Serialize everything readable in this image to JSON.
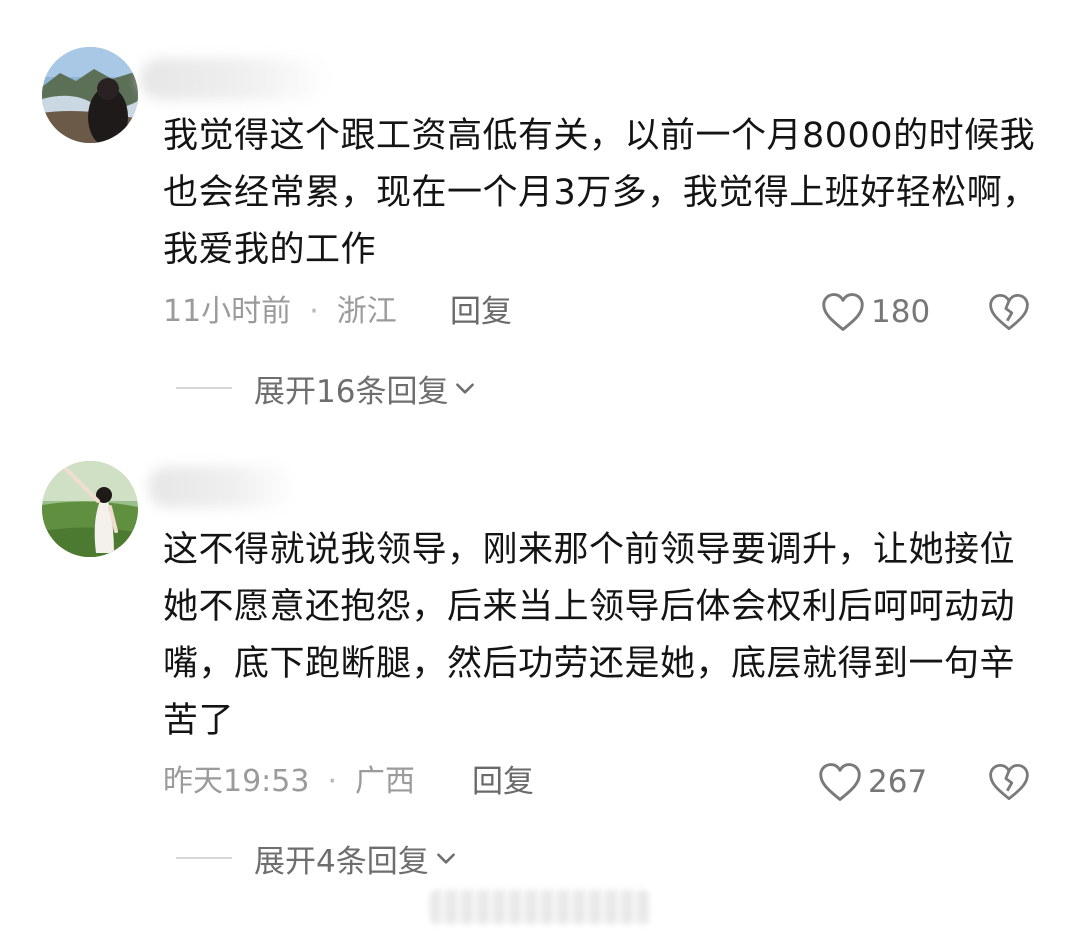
{
  "comments": [
    {
      "text": "我觉得这个跟工资高低有关，以前一个月8000的时候我也会经常累，现在一个月3万多，我觉得上班好轻松啊，我爱我的工作",
      "time": "11小时前",
      "separator": "·",
      "location": "浙江",
      "reply_label": "回复",
      "likes": "180",
      "expand_label": "展开16条回复",
      "avatar_icon": "landscape-avatar"
    },
    {
      "text": "这不得就说我领导，刚来那个前领导要调升，让她接位她不愿意还抱怨，后来当上领导后体会权利后呵呵动动嘴，底下跑断腿，然后功劳还是她，底层就得到一句辛苦了",
      "time": "昨天19:53",
      "separator": "·",
      "location": "广西",
      "reply_label": "回复",
      "likes": "267",
      "expand_label": "展开4条回复",
      "avatar_icon": "girl-grassland-avatar"
    }
  ],
  "icons": {
    "like": "heart-outline-icon",
    "dislike": "broken-heart-icon",
    "expand": "chevron-down-icon"
  },
  "colors": {
    "text": "#141414",
    "meta": "#9b9b9b",
    "icon": "#7a7a7a"
  }
}
